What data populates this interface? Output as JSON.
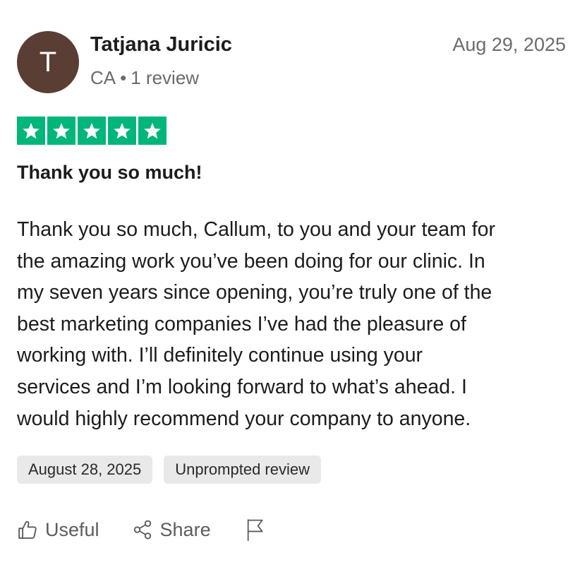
{
  "reviewer": {
    "initial": "T",
    "name": "Tatjana Juricic",
    "country": "CA",
    "separator": "•",
    "review_count": "1 review",
    "avatar_color": "#5a3d33"
  },
  "review": {
    "date": "Aug 29, 2025",
    "rating": 5,
    "rating_max": 5,
    "star_color": "#00b67a",
    "title": "Thank you so much!",
    "body_lines": [
      "Thank you so much, Callum, to you and your team for",
      "the amazing work you’ve been doing for our clinic. In",
      "my seven years since opening, you’re truly one of the",
      "best marketing companies I’ve had the pleasure of",
      "working with. I’ll definitely continue using your",
      "services and I’m looking forward to what’s ahead. I",
      "would highly recommend your company to anyone."
    ],
    "experience_date": "August 28, 2025",
    "review_source": "Unprompted review"
  },
  "actions": {
    "useful_label": "Useful",
    "share_label": "Share",
    "useful_icon": "thumbs-up-icon",
    "share_icon": "share-icon",
    "flag_icon": "flag-icon"
  }
}
